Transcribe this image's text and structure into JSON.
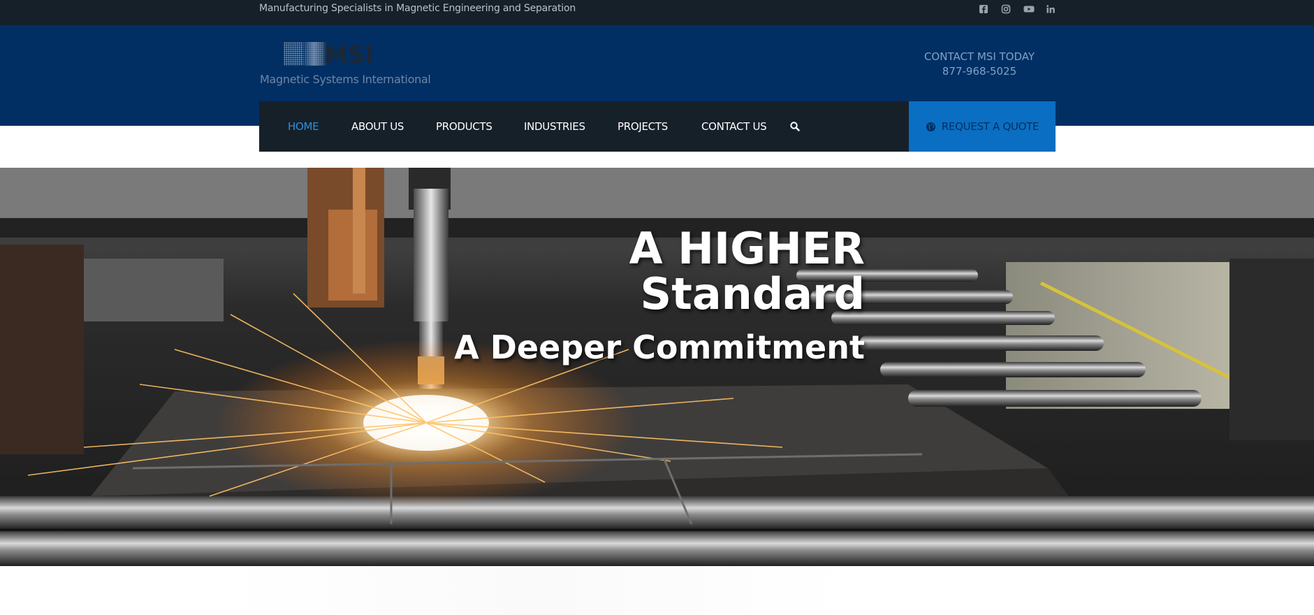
{
  "topbar": {
    "tagline": "Manufacturing Specialists in Magnetic Engineering and Separation",
    "social": [
      "facebook-icon",
      "instagram-icon",
      "youtube-icon",
      "linkedin-icon"
    ]
  },
  "header": {
    "logo_mark": "MSI",
    "logo_text": "Magnetic Systems International",
    "contact_label": "CONTACT MSI TODAY",
    "contact_phone": "877-968-5025"
  },
  "nav": {
    "items": [
      "HOME",
      "ABOUT US",
      "PRODUCTS",
      "INDUSTRIES",
      "PROJECTS",
      "CONTACT US"
    ],
    "active": "HOME",
    "quote_label": "REQUEST A QUOTE"
  },
  "hero": {
    "line1": "A HIGHER",
    "line2": "Standard",
    "line3": "A Deeper Commitment"
  },
  "colors": {
    "topbar": "#162029",
    "header": "#012f63",
    "nav": "#162029",
    "accent": "#0a6fc2",
    "active": "#2f8fd9"
  }
}
